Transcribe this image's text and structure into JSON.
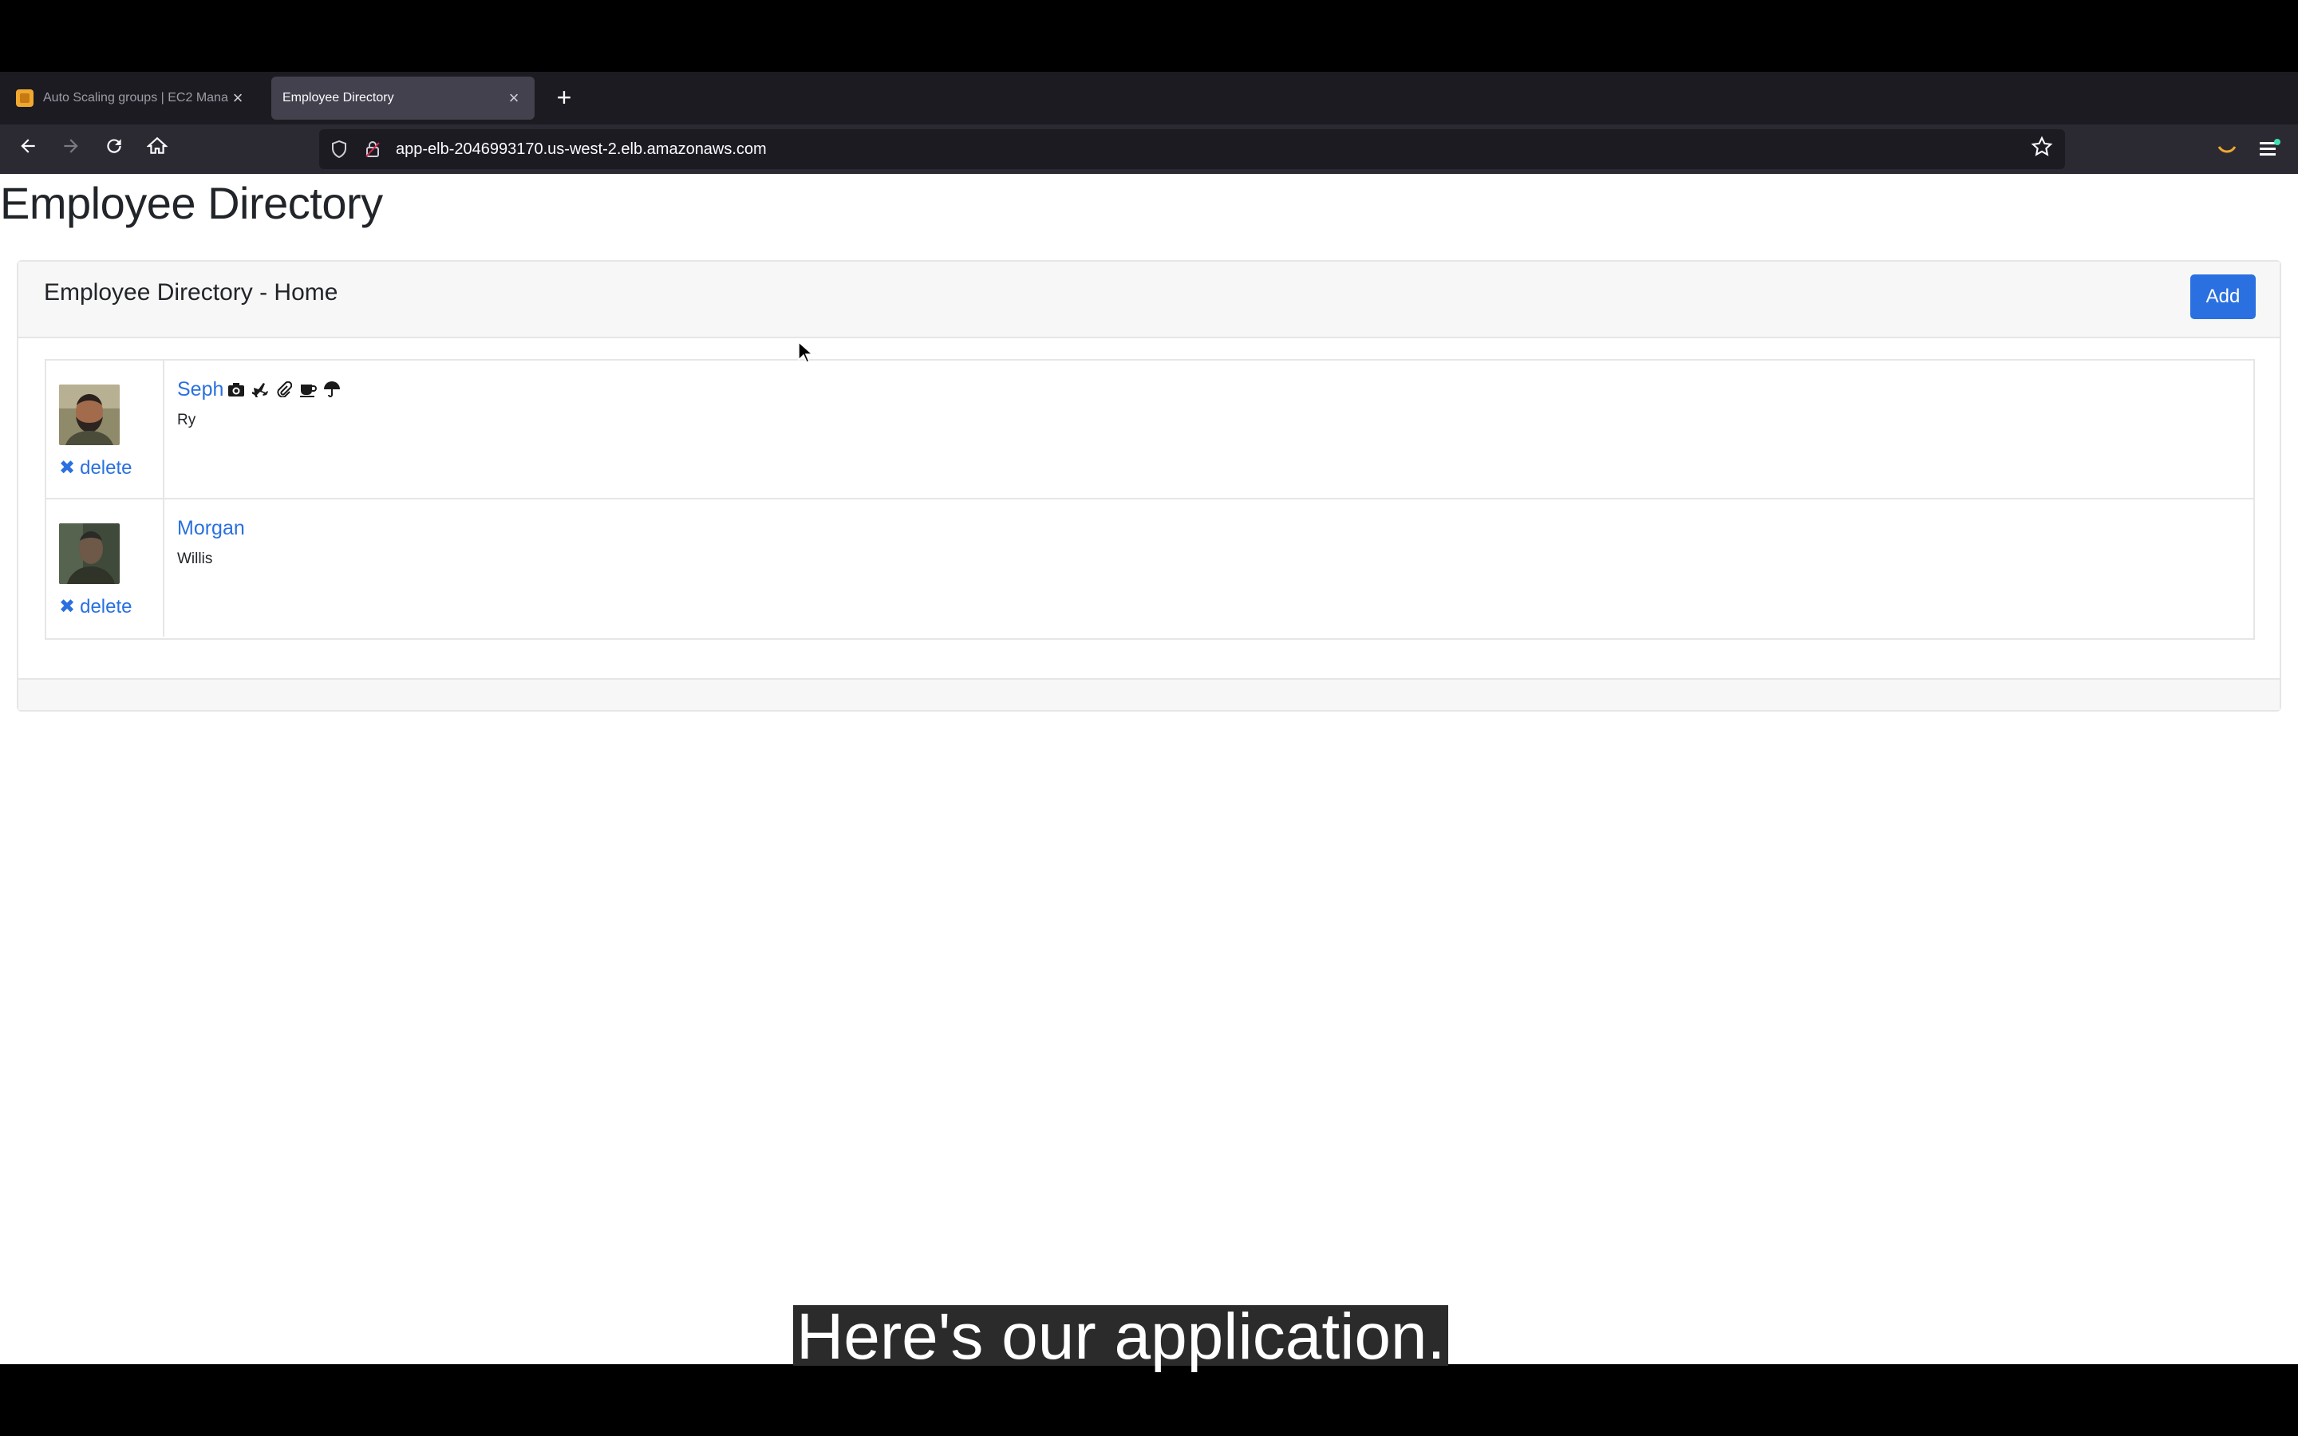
{
  "browser": {
    "tabs": [
      {
        "title": "Auto Scaling groups | EC2 Mana",
        "active": false,
        "icon": "aws-favicon"
      },
      {
        "title": "Employee Directory",
        "active": true
      }
    ],
    "new_tab_label": "+",
    "close_label": "×",
    "url": "app-elb-2046993170.us-west-2.elb.amazonaws.com"
  },
  "page": {
    "title": "Employee Directory",
    "card_title": "Employee Directory - Home",
    "add_label": "Add",
    "employees": [
      {
        "name": "Seph",
        "subtitle": "Ry",
        "delete_label": "delete",
        "badges": [
          "camera-icon",
          "plane-icon",
          "paperclip-icon",
          "coffee-icon",
          "umbrella-icon"
        ]
      },
      {
        "name": "Morgan",
        "subtitle": "Willis",
        "delete_label": "delete",
        "badges": []
      }
    ]
  },
  "caption": "Here's our application.",
  "colors": {
    "link": "#2a70e0",
    "button": "#2a70e0",
    "chrome_dark": "#1c1b22",
    "chrome_toolbar": "#2b2a33"
  }
}
